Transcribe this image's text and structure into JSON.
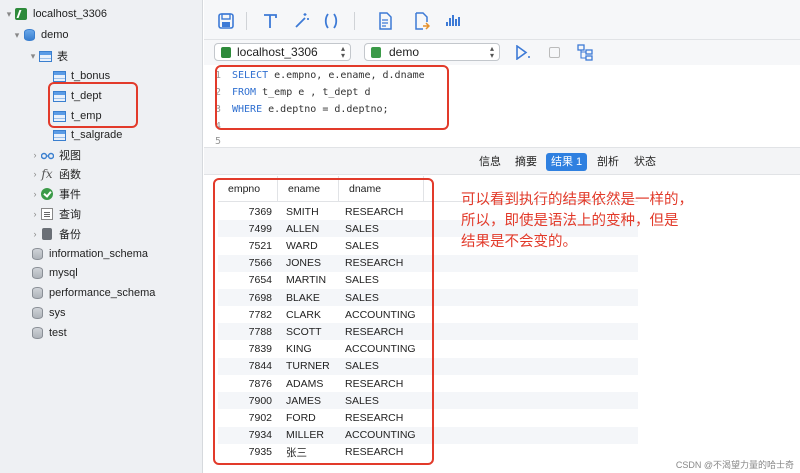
{
  "sidebar": {
    "connection": "localhost_3306",
    "database": "demo",
    "tables_folder": "表",
    "tables": [
      "t_bonus",
      "t_dept",
      "t_emp",
      "t_salgrade"
    ],
    "groups": [
      "视图",
      "函数",
      "事件",
      "查询",
      "备份"
    ],
    "other_databases": [
      "information_schema",
      "mysql",
      "performance_schema",
      "sys",
      "test"
    ]
  },
  "toolbar": {
    "icons": [
      "save-icon",
      "format-icon",
      "magic-wand-icon",
      "parentheses-icon",
      "document-icon",
      "export-icon",
      "chart-icon"
    ]
  },
  "selectors": {
    "connection": "localhost_3306",
    "database": "demo"
  },
  "editor": {
    "line_numbers": [
      "1",
      "2",
      "3",
      "4",
      "5"
    ],
    "line1_kw": "SELECT",
    "line1_rest": " e.empno, e.ename, d.dname",
    "line2_kw": "FROM",
    "line2_rest": " t_emp e , t_dept d",
    "line3_kw": "WHERE",
    "line3_rest": " e.deptno = d.deptno;"
  },
  "result_tabs": [
    "信息",
    "摘要",
    "结果 1",
    "剖析",
    "状态"
  ],
  "active_tab": "结果 1",
  "grid": {
    "columns": [
      "empno",
      "ename",
      "dname"
    ],
    "rows": [
      [
        "7369",
        "SMITH",
        "RESEARCH"
      ],
      [
        "7499",
        "ALLEN",
        "SALES"
      ],
      [
        "7521",
        "WARD",
        "SALES"
      ],
      [
        "7566",
        "JONES",
        "RESEARCH"
      ],
      [
        "7654",
        "MARTIN",
        "SALES"
      ],
      [
        "7698",
        "BLAKE",
        "SALES"
      ],
      [
        "7782",
        "CLARK",
        "ACCOUNTING"
      ],
      [
        "7788",
        "SCOTT",
        "RESEARCH"
      ],
      [
        "7839",
        "KING",
        "ACCOUNTING"
      ],
      [
        "7844",
        "TURNER",
        "SALES"
      ],
      [
        "7876",
        "ADAMS",
        "RESEARCH"
      ],
      [
        "7900",
        "JAMES",
        "SALES"
      ],
      [
        "7902",
        "FORD",
        "RESEARCH"
      ],
      [
        "7934",
        "MILLER",
        "ACCOUNTING"
      ],
      [
        "7935",
        "张三",
        "RESEARCH"
      ]
    ]
  },
  "annotation": {
    "line1": "可以看到执行的结果依然是一样的，",
    "line2": "所以，即使是语法上的变种，但是",
    "line3": "结果是不会变的。"
  },
  "watermark": "CSDN @不渴望力量的哈士奇",
  "colors": {
    "annotation_red": "#e23a2a",
    "keyword_blue": "#2f6fd0",
    "active_tab_blue": "#2f80e0"
  }
}
